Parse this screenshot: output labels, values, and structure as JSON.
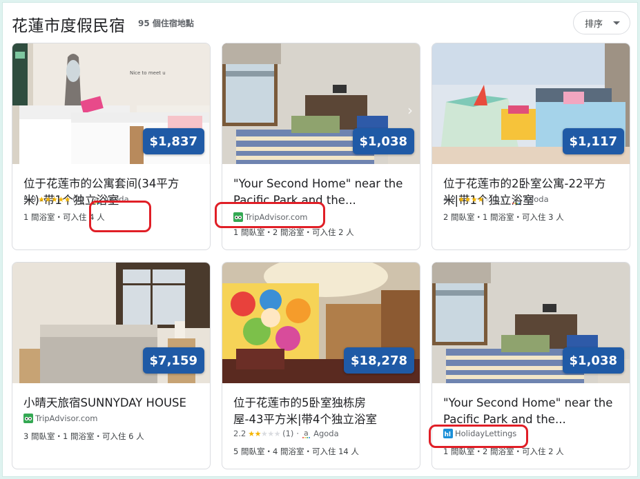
{
  "header": {
    "title": "花蓮市度假民宿",
    "count": "95 個住宿地點",
    "sort_label": "排序"
  },
  "cards": [
    {
      "price": "$1,837",
      "title": "位于花莲市的公寓套间(34平方\n米)-带1个独立浴室",
      "rating": "5.0",
      "stars_filled": 5,
      "reviews": "(2)",
      "source": "Agoda",
      "source_icon": "agoda-icon",
      "amenities": "1 間浴室・可入住 4 人"
    },
    {
      "price": "$1,038",
      "title": "\"Your Second Home\" near the\nPacific Park and the...",
      "source": "TripAdvisor.com",
      "source_icon": "tripadvisor-icon",
      "amenities": "1 間臥室・2 間浴室・可入住 2 人"
    },
    {
      "price": "$1,117",
      "title": "位于花莲市的2卧室公寓-22平方\n米|带1个独立浴室",
      "rating": "4.2",
      "stars_filled": 4,
      "reviews": "(1)",
      "source": "Agoda",
      "source_icon": "agoda-icon",
      "amenities": "2 間臥室・1 間浴室・可入住 3 人"
    },
    {
      "price": "$7,159",
      "title": "小晴天旅宿SUNNYDAY HOUSE",
      "source": "TripAdvisor.com",
      "source_icon": "tripadvisor-icon",
      "amenities": "3 間臥室・1 間浴室・可入住 6 人"
    },
    {
      "price": "$18,278",
      "title": "位于花莲市的5卧室独栋房\n屋-43平方米|带4个独立浴室",
      "rating": "2.2",
      "stars_filled": 2,
      "reviews": "(1)",
      "source": "Agoda",
      "source_icon": "agoda-icon",
      "amenities": "5 間臥室・4 間浴室・可入住 14 人"
    },
    {
      "price": "$1,038",
      "title": "\"Your Second Home\" near the\nPacific Park and the...",
      "source": "HolidayLettings",
      "source_icon": "holidaylettings-icon",
      "amenities": "1 間臥室・2 間浴室・可入住 2 人"
    }
  ],
  "colors": {
    "price_badge": "#1f5aa6",
    "star": "#f4b400",
    "annotation": "#e01e26"
  }
}
